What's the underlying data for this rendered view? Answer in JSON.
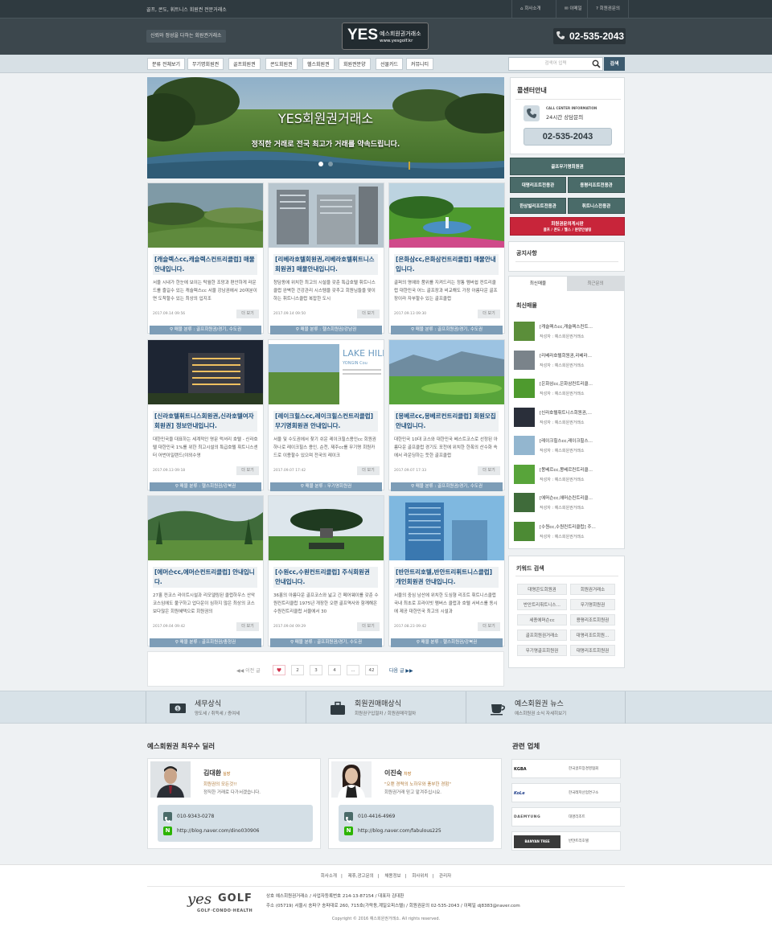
{
  "topbar": {
    "tagline": "골프, 콘도, 휘트니스 회원권 전문거래소",
    "links": [
      {
        "icon": "home-icon",
        "label": "회사소개"
      },
      {
        "icon": "mail-icon",
        "label": "이메일"
      },
      {
        "icon": "question-icon",
        "label": "회원권문의"
      }
    ]
  },
  "header": {
    "slogan": "신뢰와 정성을 다하는 회원권거래소",
    "logo_big": "YES",
    "logo_name": "예스회원권거래소",
    "logo_url": "www.yesgolf.kr",
    "phone": "02-535-2043"
  },
  "nav": {
    "items": [
      "분류 전체보기",
      "무기명회원권",
      "골프회원권",
      "콘도회원권",
      "헬스회원권",
      "회원권분양",
      "선물카드",
      "커뮤니티"
    ],
    "search_placeholder": "검색어 입력",
    "search_button": "검색"
  },
  "hero": {
    "title": "YES회원권거래소",
    "subtitle": "정직한 거래로 전국 최고가 거래를 약속드립니다.",
    "active_dot": 0,
    "dots": 2
  },
  "cards": [
    {
      "title": "[캐슬렉스cc,캐슬렉스컨트리클럽] 매물안내입니다.",
      "desc": "서울 시내가 한눈에 보이는 탁월한 조망과 편안하게 라운드를 즐길수 있는 캐슬렉스cc 서울 강남권에서 20여분이면 도착할수 있는 최상의 입지조",
      "date": "2017.09.14 09:56",
      "category": "매물 분류 : 골프회원권/경기, 수도권",
      "more": "더 보기"
    },
    {
      "title": "[리베라호텔회원권,리베라호텔휘트니스회원권] 매물안내입니다.",
      "desc": "청담동에 위치한 최고의 시설을 갖춘 특급호텔 휘트니스클럽 완벽한 건강관리 시스템을 갖추고 회원님들을 맞이하는 휘트니스클럽 복잡한 도시",
      "date": "2017.09.14 09:50",
      "category": "매물 분류 : 헬스회원권/강남권",
      "more": "더 보기"
    },
    {
      "title": "[은화삼cc,은화삼컨트리클럽] 매물안내입니다.",
      "desc": "골퍼의 명예와 품위를 지켜드리는 정통 멤버쉽 컨트리클럽 대한민국 어느 골프장과 비교해도 가장 아름다운 골프장이라 자부할수 있는 골프클럽",
      "date": "2017.09.13 09:30",
      "category": "매물 분류 : 골프회원권/경기, 수도권",
      "more": "더 보기"
    },
    {
      "title": "[신라호텔휘트니스회원권,신라호텔여자회원권] 정보안내입니다.",
      "desc": "대한민국을 대표하는 세계적인 명문 럭셔리 호텔 - 신라호텔 대한민국 1%를 위한 최고시설의 특급호텔 휘트니스센터 어번아일랜드(야외수영",
      "date": "2017.09.13 09:18",
      "category": "매물 분류 : 헬스회원권/강북권",
      "more": "더 보기"
    },
    {
      "title": "[레이크힐스cc,레이크힐스컨트리클럽] 무기명회원권 안내입니다.",
      "desc": "서울 및 수도권에서 찾기 쉬운 레이크힐스용인cc 회원권 하나로 레이크힐스 용인, 순천, 제주cc를 무기명 회원카드로 이용할수 있으며 전국의 레이크",
      "date": "2017.09.07 17:42",
      "category": "매물 분류 : 무기명회원권",
      "more": "더 보기"
    },
    {
      "title": "[몽베르cc,몽베르컨트리클럽] 회원모집 안내입니다.",
      "desc": "대한민국 10대 코스와 대한민국 베스트코스로 선정된 아름다운 골프클럽 경기도 포천에 위치한 한폭의 산수화 속에서 라운딩하는 듯한 골프클럽",
      "date": "2017.09.07 17:33",
      "category": "매물 분류 : 골프회원권/경기, 수도권",
      "more": "더 보기"
    },
    {
      "title": "[에머슨cc,에머슨컨트리클럽] 안내입니다.",
      "desc": "27홀 컨코스 라이트시설과 리모델링된 클럽하우스 산악코스임에도 불구하고 업다운이 심하지 않은 최상의 코스 보다많은 회원혜택으로 회원권의",
      "date": "2017.09.04 09:42",
      "category": "매물 분류 : 골프회원권/충청권",
      "more": "더 보기"
    },
    {
      "title": "[수원cc,수원컨트리클럽] 주식회원권 안내입니다.",
      "desc": "36홀의 아름다운 골프코스와 넓고 긴 페어웨이를 갖춘 수원컨트리클럽 1975년 개장한 오랜 골프역사와 함께해온 수원컨트리클럽 서울에서 30",
      "date": "2017.09.04 09:29",
      "category": "매물 분류 : 골프회원권/경기, 수도권",
      "more": "더 보기"
    },
    {
      "title": "[반안트리호텔,반안트리휘트니스클럽] 개인회원권 안내입니다.",
      "desc": "서울의 중심 남산에 위치한 도심형 리조트 휘트니스클럽 국내 최초로 프라이빗 멤버스 클럽과 호텔 서비스를 동시에 제공 대한민국 최고의 시설과",
      "date": "2017.08.23 09:42",
      "category": "매물 분류 : 헬스회원권/강북권",
      "more": "더 보기"
    }
  ],
  "pager": {
    "prev": "이전 글",
    "pages": [
      "2",
      "3",
      "4",
      "...",
      "42"
    ],
    "next": "다음 글"
  },
  "sidebar": {
    "callcenter": {
      "title": "콜센터안내",
      "label1": "CALL CENTER INFORMATION",
      "label2": "24시간 상담문의",
      "phone": "02-535-2043"
    },
    "buttons": {
      "full": "골프무기명회원권",
      "grid": [
        "대명리조트전용관",
        "용평리조트전용관",
        "한상빌리조트전용관",
        "휘트니스전용관"
      ],
      "red_title": "회원권문의게시판",
      "red_sub": "골프 / 콘도 / 헬스 / 분양안설팅"
    },
    "notice": {
      "title": "공지사항"
    },
    "tabs": [
      "최신매물",
      "최근문의"
    ],
    "latest": {
      "title": "최신매물",
      "writer_label": "작성자 : 예스회원권거래소",
      "items": [
        "[캐슬렉스cc,캐슬렉스컨트…",
        "[리베라호텔회원권,리베라…",
        "[은화삼cc,은화삼컨트리클…",
        "[신라호텔휘트니스회원권,…",
        "[레이크힐스cc,레이크힐스…",
        "[몽베르cc,몽베르컨트리클…",
        "[에머슨cc,에머슨컨트리클…",
        "[수원cc,수원컨트리클럽] 주…"
      ]
    },
    "keywords": {
      "title": "키워드 검색",
      "items": [
        "대명콘도회원권",
        "회원권거래소",
        "반안트리휘트니스…",
        "무기명회원권",
        "세종에머슨cc",
        "용평리조트회원권",
        "골프회원권거래소",
        "대명리조트회원…",
        "무기명골프회원권",
        "대명리조트회원권"
      ]
    }
  },
  "band": [
    {
      "icon": "money-icon",
      "title": "세무상식",
      "sub": "양도세 / 취득세 / 증여세"
    },
    {
      "icon": "briefcase-icon",
      "title": "회원권매매상식",
      "sub": "회원권구입절차 / 회원권매각절차"
    },
    {
      "icon": "cup-icon",
      "title": "예스회원권 뉴스",
      "sub": "예스회원권 소식 자세히보기"
    }
  ],
  "dealers": {
    "title": "예스회원권 최우수 딜러",
    "items": [
      {
        "name": "김대환",
        "rank": "실장",
        "q1": "회원권의 모든것!!",
        "q2": "정직한 거래로 다가서겠습니다.",
        "phone": "010-9343-0278",
        "blog": "http://blog.naver.com/dino030906"
      },
      {
        "name": "이진숙",
        "rank": "차장",
        "q1": "\"오랜 경력의 노하우와 풍부한 경험\"",
        "q2": "회원권거래 믿고 맡겨주십시요.",
        "phone": "010-4416-4969",
        "blog": "http://blog.naver.com/fabulous225"
      }
    ]
  },
  "related": {
    "title": "관련 업체",
    "items": [
      {
        "logo": "KGBA",
        "name": "한국골프장경영협회"
      },
      {
        "logo": "KoLe",
        "name": "한국레저산업연구소"
      },
      {
        "logo": "DAEMYUNG",
        "name": "대명리조트"
      },
      {
        "logo": "BANYAN TREE",
        "name": "반얀트리호텔"
      }
    ]
  },
  "footer": {
    "links": [
      "회사소개",
      "제휴,광고문의",
      "채용정보",
      "회사위치",
      "관리자"
    ],
    "logo_yes": "yes",
    "logo_golf": "GOLF",
    "logo_sub": "GOLF·CONDO·HEALTH",
    "line1": "상호  예스회원권거래소   /   사업자등록번호  214-13-87154   /   대표자  김대환",
    "line2": "주소  (05719) 서울시 송파구 송파대로 260, 715호(가락동,계일오피스텔)   /   회원권문의  02-535-2043   /   이메일  dj8383@naver.com",
    "copyright": "Copyright © 2016 예스회원권거래소. All rights reserved."
  },
  "colors": {
    "dark": "#2f3a40",
    "nav": "#d7e0e5",
    "accent": "#3c5a6e",
    "green": "#4a6b69",
    "red": "#c8253a",
    "title": "#1e4e7a"
  }
}
